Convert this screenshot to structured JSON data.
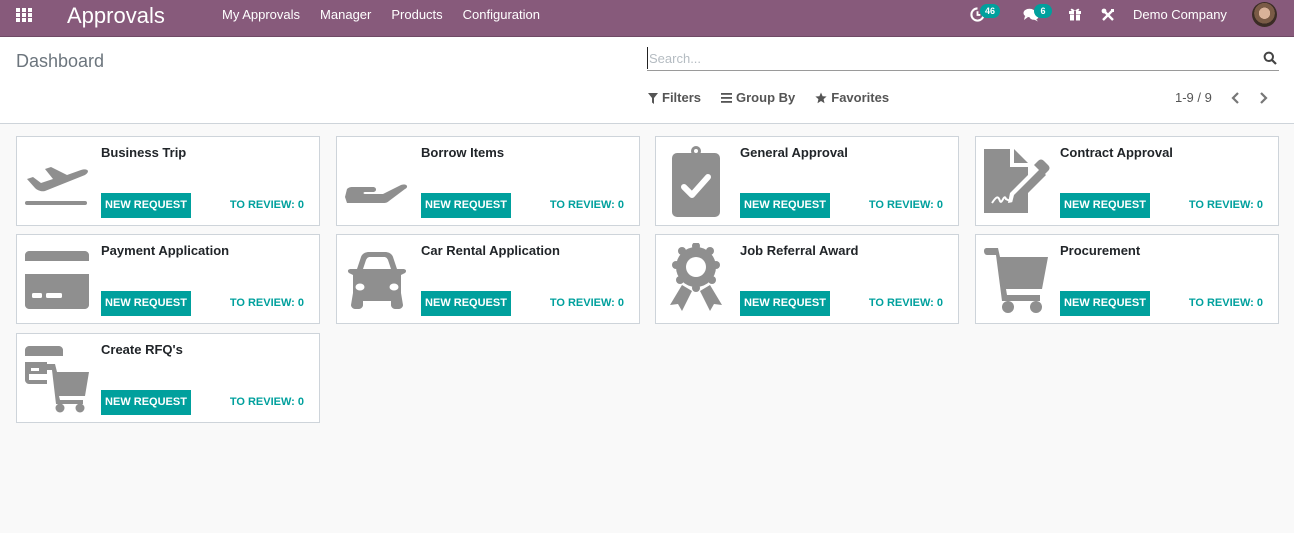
{
  "navbar": {
    "app_title": "Approvals",
    "menu": [
      {
        "label": "My Approvals"
      },
      {
        "label": "Manager"
      },
      {
        "label": "Products"
      },
      {
        "label": "Configuration"
      }
    ],
    "activity_count": "46",
    "messages_count": "6",
    "company": "Demo Company",
    "colors": {
      "navbar": "#875a7b",
      "badge": "#00a09d"
    }
  },
  "control_panel": {
    "breadcrumb": "Dashboard",
    "search_placeholder": "Search...",
    "search_value": "",
    "filters_label": "Filters",
    "group_by_label": "Group By",
    "favorites_label": "Favorites",
    "pager": "1-9 / 9"
  },
  "cards": [
    {
      "title": "Business Trip",
      "icon": "plane-departure-icon",
      "new_request": "NEW REQUEST",
      "to_review": "TO REVIEW: 0"
    },
    {
      "title": "Borrow Items",
      "icon": "hand-holding-icon",
      "new_request": "NEW REQUEST",
      "to_review": "TO REVIEW: 0"
    },
    {
      "title": "General Approval",
      "icon": "clipboard-check-icon",
      "new_request": "NEW REQUEST",
      "to_review": "TO REVIEW: 0"
    },
    {
      "title": "Contract Approval",
      "icon": "file-signature-icon",
      "new_request": "NEW REQUEST",
      "to_review": "TO REVIEW: 0"
    },
    {
      "title": "Payment Application",
      "icon": "credit-card-icon",
      "new_request": "NEW REQUEST",
      "to_review": "TO REVIEW: 0"
    },
    {
      "title": "Car Rental Application",
      "icon": "car-icon",
      "new_request": "NEW REQUEST",
      "to_review": "TO REVIEW: 0"
    },
    {
      "title": "Job Referral Award",
      "icon": "award-icon",
      "new_request": "NEW REQUEST",
      "to_review": "TO REVIEW: 0"
    },
    {
      "title": "Procurement",
      "icon": "shopping-cart-icon",
      "new_request": "NEW REQUEST",
      "to_review": "TO REVIEW: 0"
    },
    {
      "title": "Create RFQ's",
      "icon": "card-cart-icon",
      "new_request": "NEW REQUEST",
      "to_review": "TO REVIEW: 0"
    }
  ]
}
